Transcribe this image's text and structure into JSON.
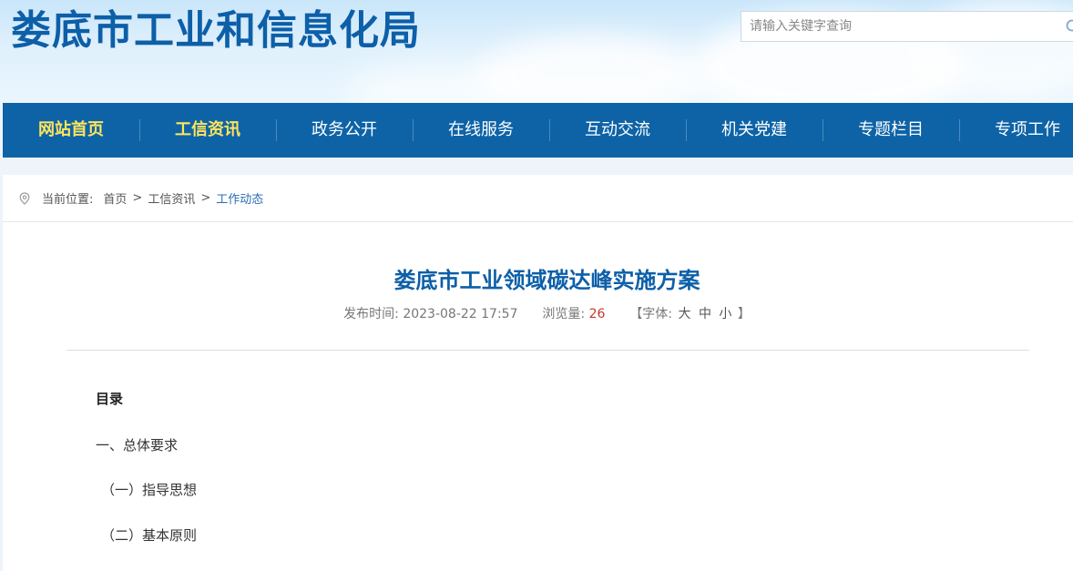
{
  "header": {
    "site_title": "娄底市工业和信息化局",
    "search_placeholder": "请输入关键字查询"
  },
  "nav": {
    "items": [
      {
        "label": "网站首页",
        "active": true
      },
      {
        "label": "工信资讯",
        "active": true
      },
      {
        "label": "政务公开",
        "active": false
      },
      {
        "label": "在线服务",
        "active": false
      },
      {
        "label": "互动交流",
        "active": false
      },
      {
        "label": "机关党建",
        "active": false
      },
      {
        "label": "专题栏目",
        "active": false
      },
      {
        "label": "专项工作",
        "active": false
      }
    ]
  },
  "breadcrumb": {
    "label": "当前位置:",
    "items": [
      "首页",
      "工信资讯",
      "工作动态"
    ],
    "separator": ">"
  },
  "article": {
    "title": "娄底市工业领域碳达峰实施方案",
    "publish_label": "发布时间:",
    "publish_time": "2023-08-22 17:57",
    "views_label": "浏览量:",
    "views": "26",
    "font_label": "【字体:",
    "font_large": "大",
    "font_medium": "中",
    "font_small": "小",
    "font_close": "】"
  },
  "toc": {
    "heading": "目录",
    "items": [
      "一、总体要求",
      "（一）指导思想",
      "（二）基本原则"
    ]
  },
  "colors": {
    "brand_blue": "#0e63a6",
    "title_blue": "#0d5fa8",
    "nav_active": "#ffe45c",
    "views_red": "#c0392b"
  }
}
